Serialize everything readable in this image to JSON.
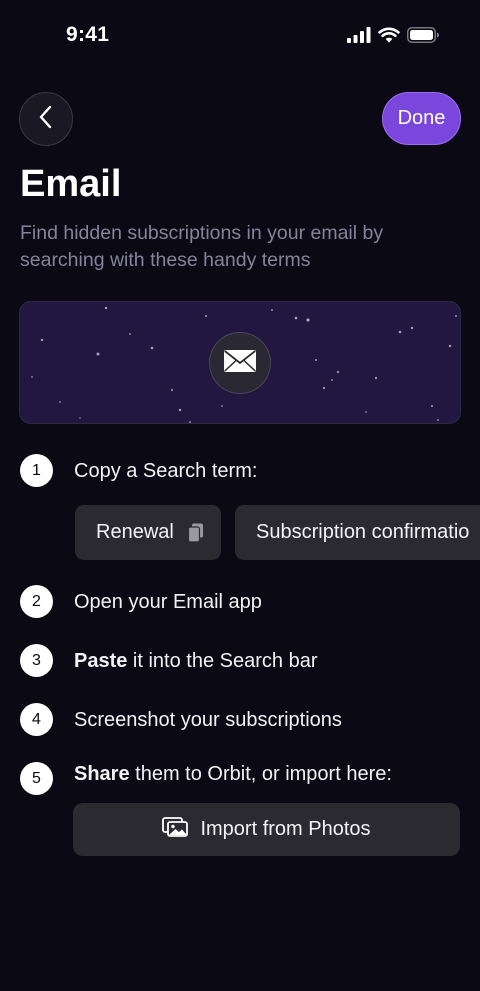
{
  "status_bar": {
    "time": "9:41",
    "icons": [
      "cellular-signal-icon",
      "wifi-icon",
      "battery-icon"
    ]
  },
  "header": {
    "back_icon": "chevron-left-icon",
    "done_label": "Done"
  },
  "title": "Email",
  "subtitle": "Find hidden subscriptions in your email by searching with these handy terms",
  "hero": {
    "icon": "envelope-icon"
  },
  "steps": [
    {
      "number": "1",
      "text": "Copy a Search term:"
    },
    {
      "number": "2",
      "text": "Open your Email app"
    },
    {
      "number": "3",
      "bold": "Paste",
      "text": " it into the Search bar"
    },
    {
      "number": "4",
      "text": "Screenshot your subscriptions"
    },
    {
      "number": "5",
      "bold": "Share",
      "text": " them to Orbit, or import here:"
    }
  ],
  "search_terms": [
    {
      "label": "Renewal",
      "icon": "copy-icon"
    },
    {
      "label": "Subscription confirmatio"
    }
  ],
  "import_button": {
    "icon": "photos-icon",
    "label": "Import from Photos"
  },
  "colors": {
    "background": "#0b0914",
    "accent": "#7a46dc",
    "hero_background": "#221741",
    "chip_background": "#2b2a30",
    "subtitle_text": "#85839a"
  }
}
